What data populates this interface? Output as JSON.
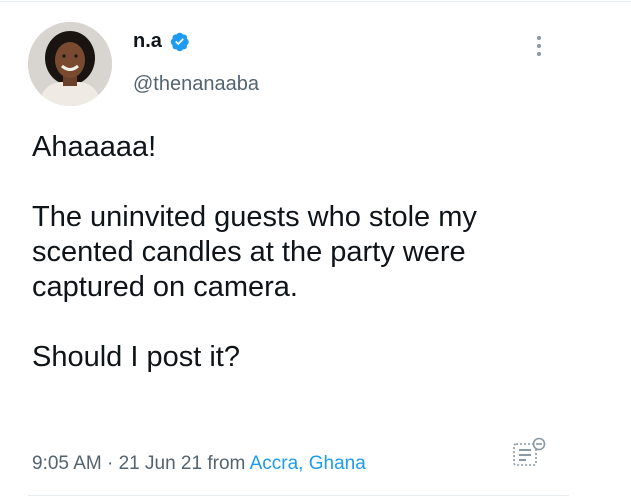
{
  "author": {
    "display_name": "n.a",
    "handle": "@thenanaaba",
    "verified": true
  },
  "icons": {
    "verified": "verified-badge-icon",
    "more": "more-options-icon",
    "analytics": "tweet-analytics-icon"
  },
  "tweet": {
    "paragraphs": [
      "Ahaaaaa!",
      "The uninvited guests who stole my scented candles at the party were captured on camera.",
      "Should I post it?"
    ]
  },
  "meta": {
    "time": "9:05 AM",
    "separator": "·",
    "date": "21 Jun 21",
    "from_label": "from",
    "location": "Accra, Ghana"
  },
  "colors": {
    "text": "#0f1419",
    "secondary": "#536471",
    "accent": "#1d9bf0"
  }
}
